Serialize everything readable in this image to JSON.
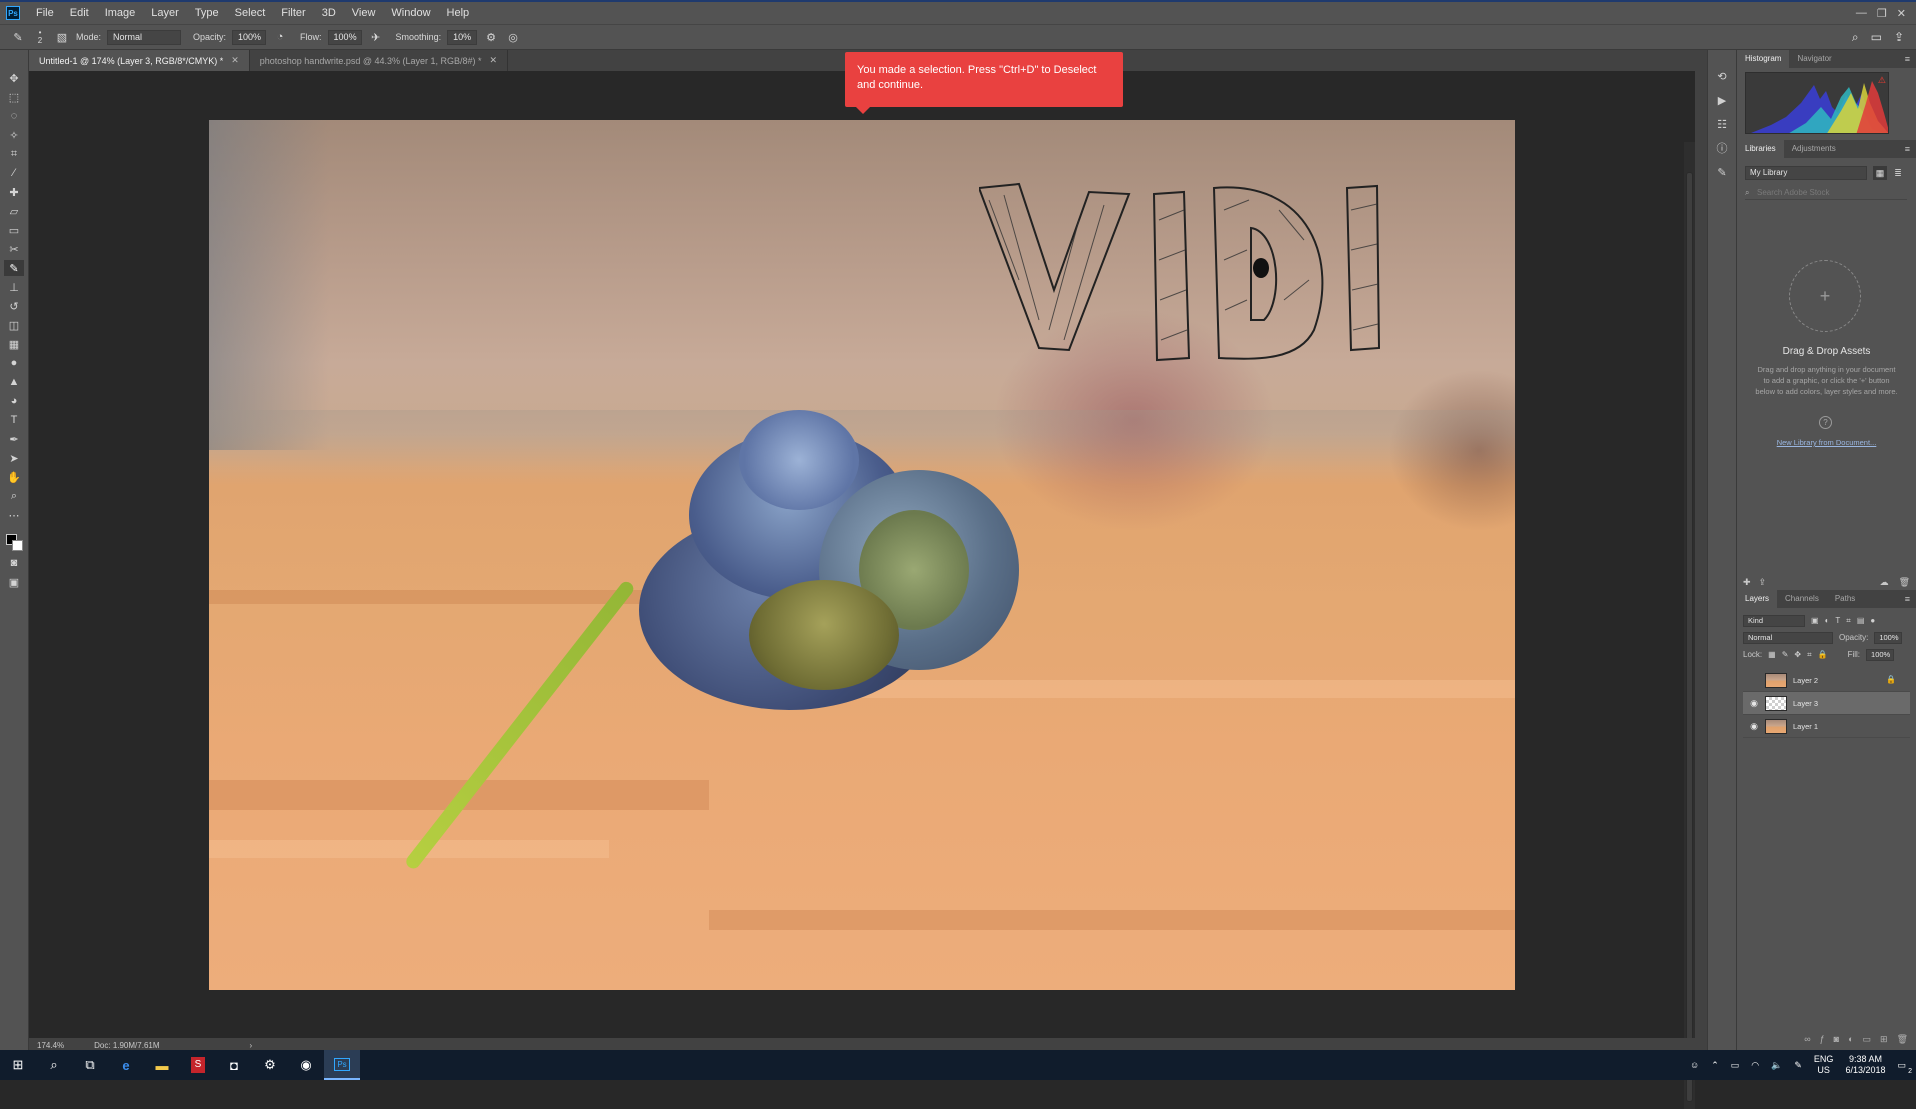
{
  "app": {
    "logo": "Ps",
    "menu": [
      "File",
      "Edit",
      "Image",
      "Layer",
      "Type",
      "Select",
      "Filter",
      "3D",
      "View",
      "Window",
      "Help"
    ],
    "window_controls": [
      "—",
      "❐",
      "✕"
    ]
  },
  "options_bar": {
    "brush_size": "2",
    "mode_label": "Mode:",
    "mode_value": "Normal",
    "opacity_label": "Opacity:",
    "opacity_value": "100%",
    "flow_label": "Flow:",
    "flow_value": "100%",
    "smoothing_label": "Smoothing:",
    "smoothing_value": "10%"
  },
  "tabs": [
    {
      "label": "Untitled-1 @ 174% (Layer 3, RGB/8*/CMYK) *",
      "active": true
    },
    {
      "label": "photoshop handwrite.psd @ 44.3% (Layer 1, RGB/8#) *",
      "active": false
    }
  ],
  "canvas": {
    "lettering": "VIDI"
  },
  "toast": {
    "message": "You made a selection. Press \"Ctrl+D\" to Deselect and continue."
  },
  "status": {
    "zoom": "174.4%",
    "doc": "Doc: 1.90M/7.61M",
    "arrow": "›"
  },
  "panels": {
    "histogram_tabs": [
      "Histogram",
      "Navigator"
    ],
    "libraries_tabs": [
      "Libraries",
      "Adjustments"
    ],
    "library_select": "My Library",
    "library_search_placeholder": "Search Adobe Stock",
    "drop_title": "Drag & Drop Assets",
    "drop_desc": "Drag and drop anything in your document to add a graphic, or click the '+' button below to add colors, layer styles and more.",
    "new_library_link": "New Library from Document...",
    "layers_tabs": [
      "Layers",
      "Channels",
      "Paths"
    ],
    "filter_kind": "Kind",
    "blend_mode": "Normal",
    "opacity_label": "Opacity:",
    "opacity_value": "100%",
    "lock_label": "Lock:",
    "fill_label": "Fill:",
    "fill_value": "100%",
    "layers": [
      {
        "name": "Layer 2",
        "visible": false,
        "locked": true
      },
      {
        "name": "Layer 3",
        "visible": true,
        "active": true
      },
      {
        "name": "Layer 1",
        "visible": true
      }
    ]
  },
  "taskbar": {
    "lang": "ENG",
    "region": "US",
    "time": "9:38 AM",
    "date": "6/13/2018",
    "notifications": "2"
  },
  "colors": {
    "toast_bg": "#e94140",
    "ui_panel": "#535353",
    "canvas_bg": "#282828",
    "taskbar": "#101c2c"
  }
}
